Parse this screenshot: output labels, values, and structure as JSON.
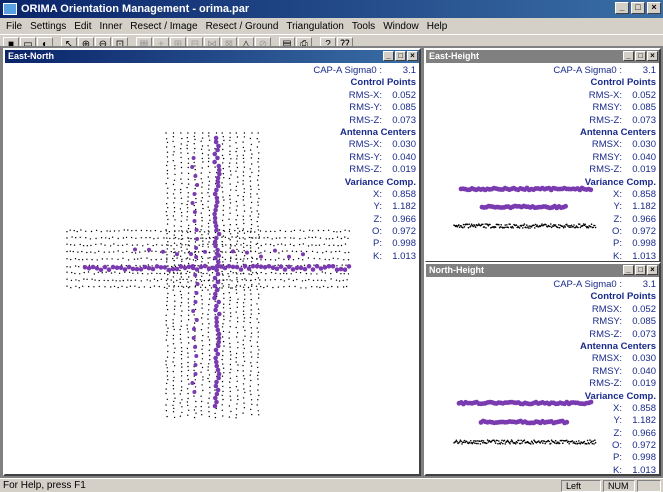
{
  "app": {
    "title": "ORIMA Orientation Management - orima.par",
    "window_buttons": [
      "_",
      "□",
      "×"
    ]
  },
  "menu": [
    "File",
    "Settings",
    "Edit",
    "Inner",
    "Resect / Image",
    "Resect / Ground",
    "Triangulation",
    "Tools",
    "Window",
    "Help"
  ],
  "toolbar": {
    "buttons": [
      "save-icon",
      "new-window-icon",
      "open-icon",
      "pointer-icon",
      "zoom-in-icon",
      "zoom-out-icon",
      "zoom-fit-icon",
      "grid-icon",
      "add-point-icon",
      "measure-icon",
      "resection-icon",
      "image-icon",
      "ground-icon",
      "triangulate-icon",
      "settings-icon",
      "report-icon",
      "print-icon",
      "help-icon",
      "context-help-icon"
    ]
  },
  "windows": {
    "east_north": {
      "title": "East-North"
    },
    "east_height": {
      "title": "East-Height"
    },
    "north_height": {
      "title": "North-Height"
    }
  },
  "stats": {
    "cap_a_sigma0": "CAP-A Sigma0 :",
    "sigma0_value": "3.1",
    "control_points": "Control Points",
    "rms_x": "RMS-X:",
    "rms_x_value": "0.052",
    "rms_y": "RMS-Y:",
    "rms_y_value": "0.085",
    "rms_z": "RMS-Z:",
    "rms_z_value": "0.073",
    "antenna_centers": "Antenna Centers",
    "rms_x_ac_value": "0.030",
    "rms_y_ac_value": "0.040",
    "rms_z_ac_value": "0.019",
    "variance_comp": "Variance Comp.",
    "x": "X:",
    "x_value": "0.858",
    "y": "Y:",
    "y_value": "1.182",
    "z": "Z:",
    "z_value": "0.966",
    "o": "O:",
    "o_value": "0.972",
    "p": "P:",
    "p_value": "0.998",
    "k": "K:",
    "k_value": "1.013"
  },
  "stats_eh_labels": {
    "rms_x": "RMS-X:",
    "rms_y": "RMSY:",
    "rms_z": "RMS-Z:",
    "rms_x_ac": "RMSX:",
    "rms_y_ac": "RMSY:",
    "rms_z_ac": "RMS-Z:"
  },
  "stats_nh_labels": {
    "rms_x": "RMSX:",
    "rms_y": "RMSY:",
    "rms_z": "RMS-Z:",
    "rms_x_ac": "RMSX:",
    "rms_y_ac": "RMSY:",
    "rms_z_ac": "RMS-Z:"
  },
  "status": {
    "help_text": "For Help, press F1",
    "mode": "Left",
    "num": "NUM"
  },
  "colors": {
    "antenna": "#7a3ab0",
    "points": "#000000",
    "stat_text": "#1a2a8a"
  }
}
